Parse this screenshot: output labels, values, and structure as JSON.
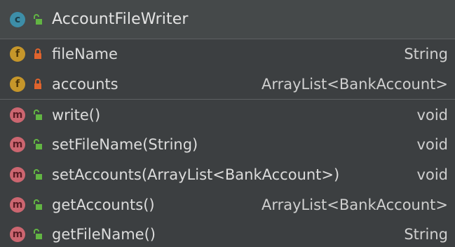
{
  "class": {
    "badge": "c",
    "name": "AccountFileWriter"
  },
  "fields": [
    {
      "badge": "f",
      "name": "fileName",
      "type": "String",
      "visibility": "private"
    },
    {
      "badge": "f",
      "name": "accounts",
      "type": "ArrayList<BankAccount>",
      "visibility": "private"
    }
  ],
  "methods": [
    {
      "badge": "m",
      "name": "write()",
      "type": "void",
      "visibility": "public"
    },
    {
      "badge": "m",
      "name": "setFileName(String)",
      "type": "void",
      "visibility": "public"
    },
    {
      "badge": "m",
      "name": "setAccounts(ArrayList<BankAccount>)",
      "type": "void",
      "visibility": "public"
    },
    {
      "badge": "m",
      "name": "getAccounts()",
      "type": "ArrayList<BankAccount>",
      "visibility": "public"
    },
    {
      "badge": "m",
      "name": "getFileName()",
      "type": "String",
      "visibility": "public"
    }
  ],
  "colors": {
    "background": "#3c3f41",
    "class_badge": "#3d8ea8",
    "field_badge": "#c6962a",
    "method_badge": "#cc6670",
    "public_lock": "#62b543",
    "private_lock": "#e0642d"
  },
  "icons": {
    "public": "unlocked-padlock-icon",
    "private": "locked-padlock-icon"
  }
}
